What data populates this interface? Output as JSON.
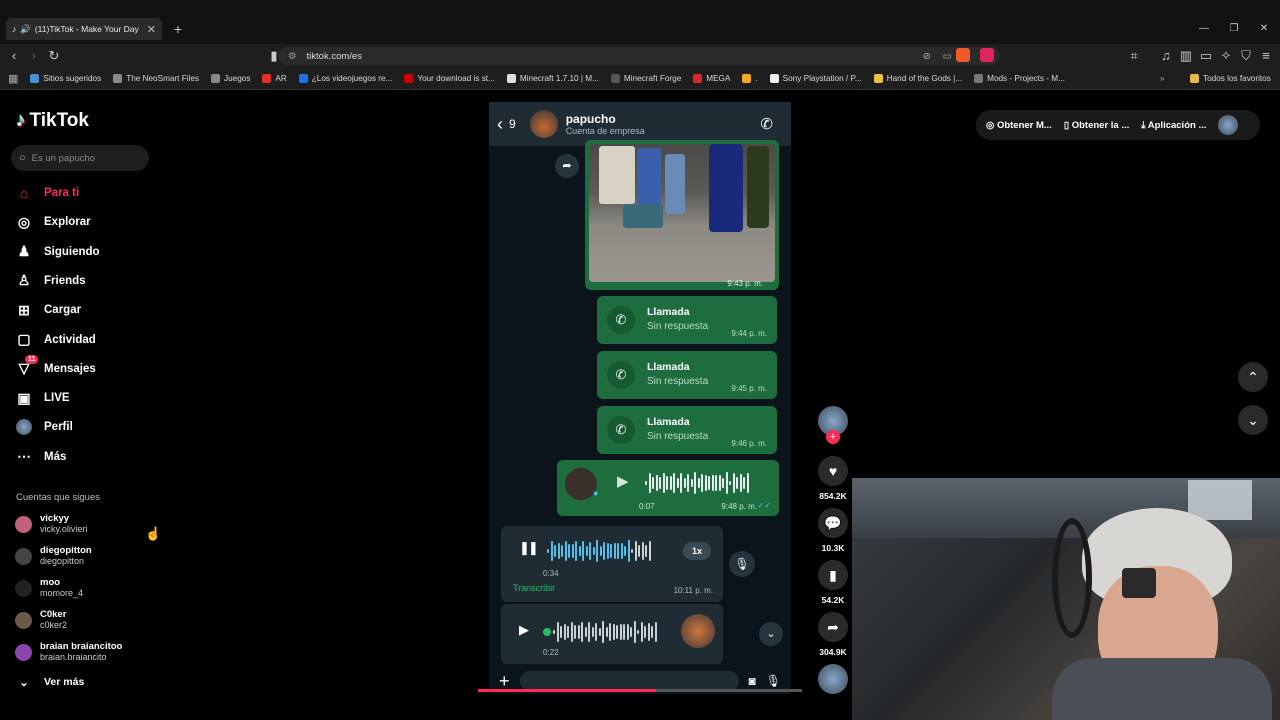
{
  "browser": {
    "tab_title": "(11)TikTok - Make Your Day",
    "url": "tiktok.com/es",
    "bookmarks": [
      {
        "label": "Sitios sugeridos",
        "color": "#4a90d9"
      },
      {
        "label": "The NeoSmart Files",
        "color": "#888888"
      },
      {
        "label": "Juegos",
        "color": "#888888"
      },
      {
        "label": "AR",
        "color": "#e52d27"
      },
      {
        "label": "¿Los videojuegos re...",
        "color": "#1a73e8"
      },
      {
        "label": "Your download is st...",
        "color": "#cc0000"
      },
      {
        "label": "Minecraft 1.7.10 | M...",
        "color": "#dddddd"
      },
      {
        "label": "Minecraft Forge",
        "color": "#555555"
      },
      {
        "label": "MEGA",
        "color": "#d9272e"
      },
      {
        "label": ".",
        "color": "#f5a623"
      },
      {
        "label": "Sony Playstation / P...",
        "color": "#eeeeee"
      },
      {
        "label": "Hand of the Gods |...",
        "color": "#f0c040"
      },
      {
        "label": "Mods - Projects - M...",
        "color": "#777777"
      }
    ],
    "all_favorites": "Todos los favoritos"
  },
  "tiktok": {
    "logo": "TikTok",
    "search_placeholder": "Es un papucho",
    "nav": [
      {
        "label": "Para ti",
        "icon": "home-icon",
        "active": true
      },
      {
        "label": "Explorar",
        "icon": "compass-icon"
      },
      {
        "label": "Siguiendo",
        "icon": "following-icon"
      },
      {
        "label": "Friends",
        "icon": "friends-icon"
      },
      {
        "label": "Cargar",
        "icon": "upload-icon"
      },
      {
        "label": "Actividad",
        "icon": "activity-icon"
      },
      {
        "label": "Mensajes",
        "icon": "messages-icon",
        "badge": "11"
      },
      {
        "label": "LIVE",
        "icon": "live-icon"
      },
      {
        "label": "Perfil",
        "icon": "profile-avatar-icon"
      },
      {
        "label": "Más",
        "icon": "more-icon"
      }
    ],
    "following_header": "Cuentas que sigues",
    "accounts": [
      {
        "name": "vickyy",
        "user": "vicky.olivieri",
        "color": "#c0607a"
      },
      {
        "name": "diegopitton",
        "user": "diegopitton",
        "color": "#444444"
      },
      {
        "name": "moo",
        "user": "momore_4",
        "color": "#222222"
      },
      {
        "name": "C0ker",
        "user": "c0ker2",
        "color": "#6a5a4a"
      },
      {
        "name": "braian braiancitoo",
        "user": "braian.braiancito",
        "color": "#8e44ad"
      }
    ],
    "see_more": "Ver más",
    "top_buttons": [
      "Obtener M...",
      "Obtener la ...",
      "Aplicación ..."
    ],
    "actions": {
      "likes": "854.2K",
      "comments": "10.3K",
      "saves": "54.2K",
      "shares": "304.9K"
    }
  },
  "chat": {
    "back_count": "9",
    "contact": "papucho",
    "subtitle": "Cuenta de empresa",
    "photo_time": "9:43 p. m.",
    "calls": [
      {
        "title": "Llamada",
        "status": "Sin respuesta",
        "time": "9:44 p. m."
      },
      {
        "title": "Llamada",
        "status": "Sin respuesta",
        "time": "9:45 p. m."
      },
      {
        "title": "Llamada",
        "status": "Sin respuesta",
        "time": "9:46 p. m."
      }
    ],
    "voice_out": {
      "duration": "0:07",
      "time": "9:48 p. m."
    },
    "voice_in_1": {
      "duration": "0:34",
      "speed": "1x",
      "transcribe": "Transcribir",
      "time": "10:11 p. m."
    },
    "voice_in_2": {
      "duration": "0:22"
    }
  }
}
